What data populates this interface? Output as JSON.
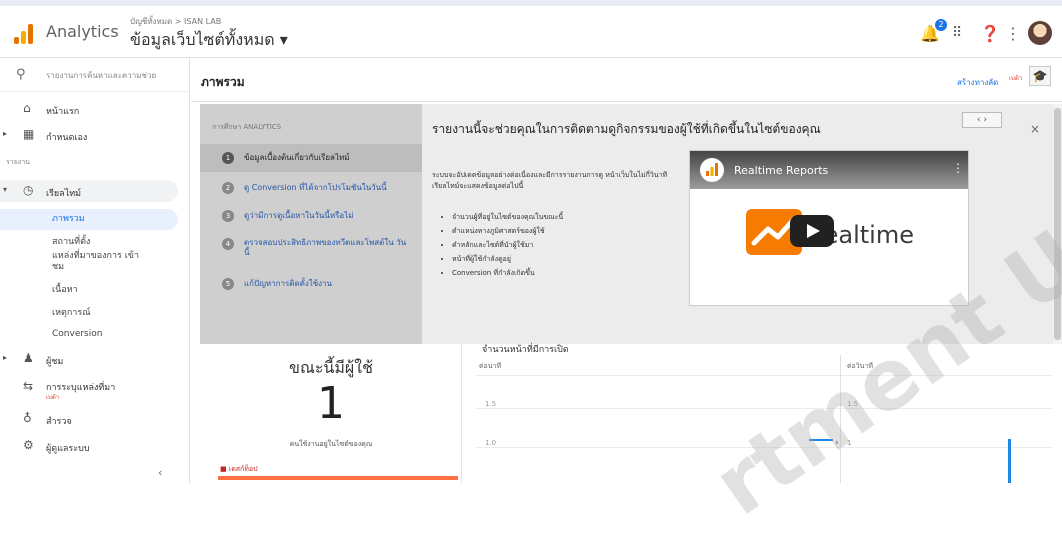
{
  "header": {
    "app_name": "Analytics",
    "account_path": "บัญชีทั้งหมด > ISAN LAB",
    "view_name": "ข้อมูลเว็บไซต์ทั้งหมด ▾",
    "notification_count": "2",
    "icons": [
      "notifications-icon",
      "apps-icon",
      "help-icon",
      "more-vert-icon",
      "avatar"
    ]
  },
  "sidebar": {
    "search_placeholder": "รายงานการค้นหาและความช่วย",
    "items": [
      {
        "label": "หน้าแรก",
        "icon": "home-icon"
      },
      {
        "label": "กำหนดเอง",
        "icon": "dashboard-icon"
      }
    ],
    "reports_header": "รายงาน",
    "realtime": {
      "label": "เรียลไทม์",
      "icon": "clock-icon",
      "children": [
        "ภาพรวม",
        "สถานที่ตั้ง",
        "แหล่งที่มาของการ เข้าชม",
        "เนื้อหา",
        "เหตุการณ์",
        "Conversion"
      ]
    },
    "audience": {
      "label": "ผู้ชม",
      "icon": "person-icon"
    },
    "acquisition": {
      "label": "การระบุแหล่งที่มา",
      "badge": "เบต้า",
      "icon": "acquisition-icon"
    },
    "discover": {
      "label": "สำรวจ",
      "icon": "lightbulb-icon"
    },
    "admin": {
      "label": "ผู้ดูแลระบบ",
      "icon": "gear-icon"
    },
    "collapse_glyph": "‹"
  },
  "titlebar": {
    "title": "ภาพรวม",
    "create_shortcut": "สร้างทางลัด",
    "new_tag": "เบต้า"
  },
  "tour": {
    "header": "การศึกษา ANALYTICS",
    "steps": [
      {
        "num": "1",
        "label": "ข้อมูลเบื้องต้นเกี่ยวกับเรียลไทม์"
      },
      {
        "num": "2",
        "label": "ดู Conversion ที่ได้จากโปรโมชันในวันนี้"
      },
      {
        "num": "3",
        "label": "ดูว่ามีการดูเนื้อหาในวันนี้หรือไม่"
      },
      {
        "num": "4",
        "label": "ตรวจสอบประสิทธิภาพของทวีตและโพสต์ใน วันนี้"
      },
      {
        "num": "5",
        "label": "แก้ปัญหาการติดตั้งใช้งาน"
      }
    ],
    "title": "รายงานนี้จะช่วยคุณในการติดตามดูกิจกรรมของผู้ใช้ที่เกิดขึ้นในไซต์ของคุณ",
    "nav": "‹  ›",
    "close": "×",
    "description": "ระบบจะอัปเดตข้อมูลอย่างต่อเนื่องและมีการรายงานการดู หน้าเว็บในไม่กี่วินาที เรียลไทม์จะแสดงข้อมูลต่อไปนี้",
    "bullets": [
      "จำนวนผู้ที่อยู่ในไซต์ของคุณในขณะนี้",
      "ตำแหน่งทางภูมิศาสตร์ของผู้ใช้",
      "คำหลักและไซต์ที่นำผู้ใช้มา",
      "หน้าที่ผู้ใช้กำลังดูอยู่",
      "Conversion ที่กำลังเกิดขึ้น"
    ],
    "video": {
      "title": "Realtime Reports",
      "menu": "⋮",
      "big_text": "Realtime"
    }
  },
  "active_users": {
    "title": "ขณะนี้มีผู้ใช้",
    "value": "1",
    "caption": "คนใช้งานอยู่ในไซต์ของคุณ",
    "tab": "เดสก์ท็อป"
  },
  "pageviews": {
    "title": "จำนวนหน้าที่มีการเปิด",
    "left_label": "ต่อนาที",
    "right_label": "ต่อวินาที",
    "ticks_left": [
      "1.5",
      "1.0"
    ],
    "ticks_right": [
      "1.5",
      "1"
    ]
  },
  "colors": {
    "accent": "#1a73e8",
    "logo_orange": "#f9ab00",
    "logo_dark": "#e37400",
    "badge": "#e53935",
    "bar": "#1e88e5"
  },
  "watermark": "rtment  Univers"
}
